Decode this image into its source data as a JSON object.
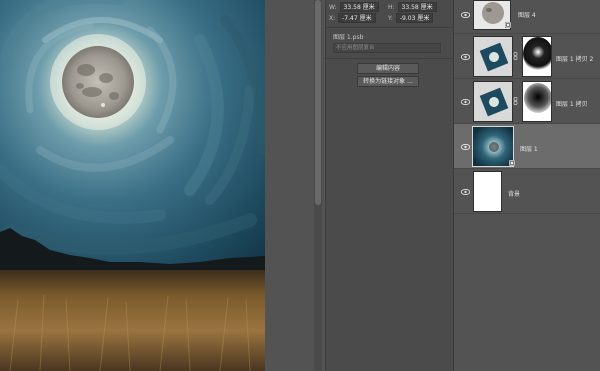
{
  "properties": {
    "w_label": "W:",
    "w_value": "33.58 厘米",
    "h_label": "H:",
    "h_value": "33.58 厘米",
    "x_label": "X:",
    "x_value": "-7.47 厘米",
    "y_label": "Y:",
    "y_value": "-9.03 厘米",
    "file_name": "图层 1.psb",
    "layer_comp_placeholder": "不应用图层复合",
    "edit_contents_label": "编辑内容",
    "convert_to_linked_label": "转换为链接对象 ..."
  },
  "layers": [
    {
      "name": "图层 4"
    },
    {
      "name": "图层 1 拷贝 2"
    },
    {
      "name": "图层 1 拷贝"
    },
    {
      "name": "图层 1",
      "selected": true
    },
    {
      "name": "背景"
    }
  ],
  "icons": {
    "visibility": "eye-icon",
    "smart_object_badge": "smart-object-icon",
    "mask_link": "chain-link-icon"
  },
  "colors": {
    "panel_bg": "#535353",
    "selected_layer": "#6c6c6c",
    "sky_deep": "#16384a",
    "sky_light": "#5d8fa3",
    "grass": "#8a6a36"
  }
}
